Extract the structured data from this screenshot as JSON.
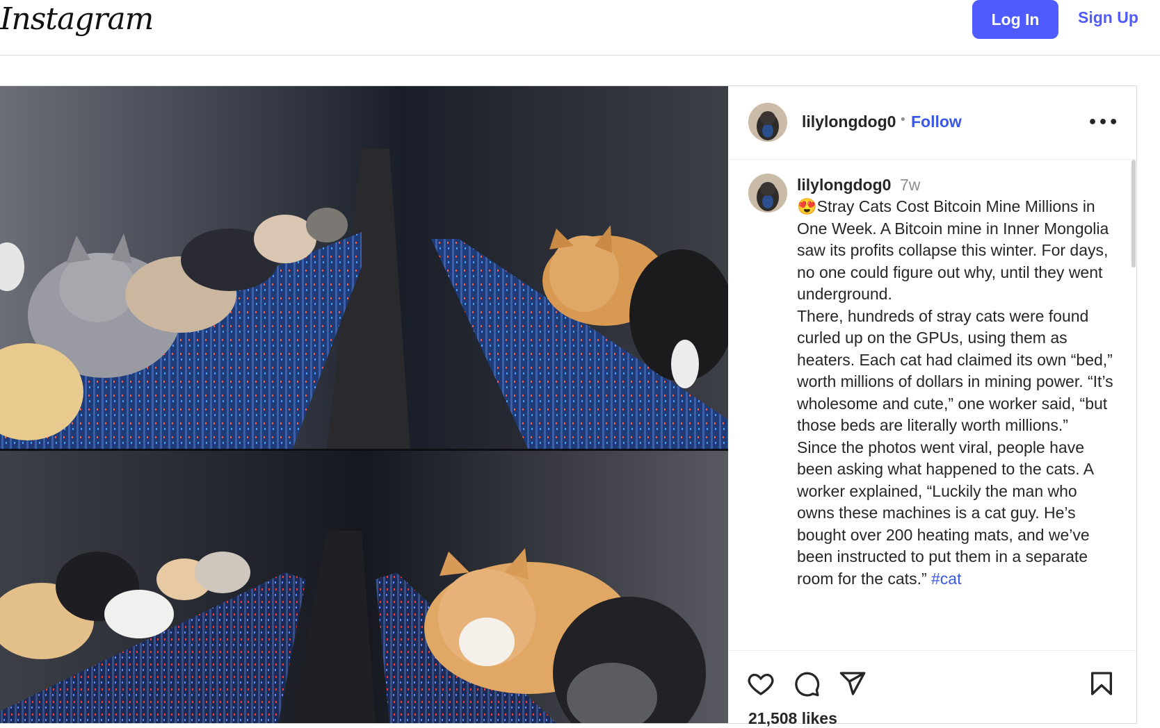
{
  "header": {
    "logo_text": "Instagram",
    "login_label": "Log In",
    "signup_label": "Sign Up",
    "accent_color": "#4f5bff"
  },
  "post": {
    "author": "lilylongdog0",
    "follow_label": "Follow",
    "more_icon": "more-horizontal-icon",
    "caption": {
      "username": "lilylongdog0",
      "time": "7w",
      "emoji": "😍",
      "paragraphs": [
        "Stray Cats Cost Bitcoin Mine Millions in One Week. A Bitcoin mine in Inner Mongolia saw its profits collapse this winter. For days, no one could figure out why, until they went underground.",
        "There, hundreds of stray cats were found curled up on the GPUs, using them as heaters. Each cat had claimed its own “bed,” worth millions of dollars in mining power. “It’s wholesome and cute,” one worker said, “but those beds are literally worth millions.”",
        "Since the photos went viral, people have been asking what happened to the cats. A worker explained, “Luckily the man who owns these machines is a cat guy. He’s bought over 200 heating mats, and we’ve been instructed to put them in a separate room for the cats.”"
      ],
      "hashtag": "#cat"
    },
    "actions": {
      "like_icon": "heart-icon",
      "comment_icon": "comment-icon",
      "share_icon": "share-icon",
      "save_icon": "bookmark-icon"
    },
    "likes": "21,508 likes"
  }
}
